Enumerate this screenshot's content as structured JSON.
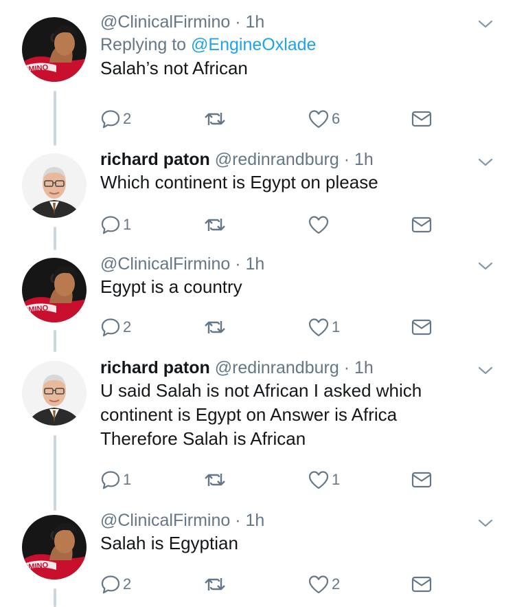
{
  "thread": [
    {
      "author_type": "firmino",
      "display_name": "",
      "handle": "@ClinicalFirmino",
      "sep": "·",
      "time": "1h",
      "replying_label": "Replying to",
      "replying_to": "@EngineOxlade",
      "text_lines": [
        "Salah’s not African"
      ],
      "replies": "2",
      "retweets": "",
      "likes": "6"
    },
    {
      "author_type": "richard",
      "display_name": "richard paton",
      "handle": "@redinrandburg",
      "sep": "·",
      "time": "1h",
      "text_lines": [
        "Which continent is Egypt on please"
      ],
      "replies": "1",
      "retweets": "",
      "likes": ""
    },
    {
      "author_type": "firmino",
      "display_name": "",
      "handle": "@ClinicalFirmino",
      "sep": "·",
      "time": "1h",
      "text_lines": [
        "Egypt is a country"
      ],
      "replies": "2",
      "retweets": "",
      "likes": "1"
    },
    {
      "author_type": "richard",
      "display_name": "richard paton",
      "handle": "@redinrandburg",
      "sep": "·",
      "time": "1h",
      "text_lines": [
        "U said Salah is not African I asked which",
        "continent is Egypt on Answer is Africa",
        "Therefore Salah is African"
      ],
      "replies": "1",
      "retweets": "",
      "likes": "1"
    },
    {
      "author_type": "firmino",
      "display_name": "",
      "handle": "@ClinicalFirmino",
      "sep": "·",
      "time": "1h",
      "text_lines": [
        "Salah is Egyptian"
      ],
      "replies": "2",
      "retweets": "",
      "likes": "2"
    }
  ],
  "avatar_jersey_text": "RMINO",
  "colors": {
    "text": "#14171a",
    "secondary": "#657786",
    "link": "#1da1f2",
    "thread_line": "#ccd6dd",
    "icon": "#657786",
    "jersey_red": "#c8102e"
  },
  "icons": {
    "reply": "reply-icon",
    "retweet": "retweet-icon",
    "like": "heart-icon",
    "dm": "envelope-icon",
    "more": "chevron-down-icon"
  }
}
